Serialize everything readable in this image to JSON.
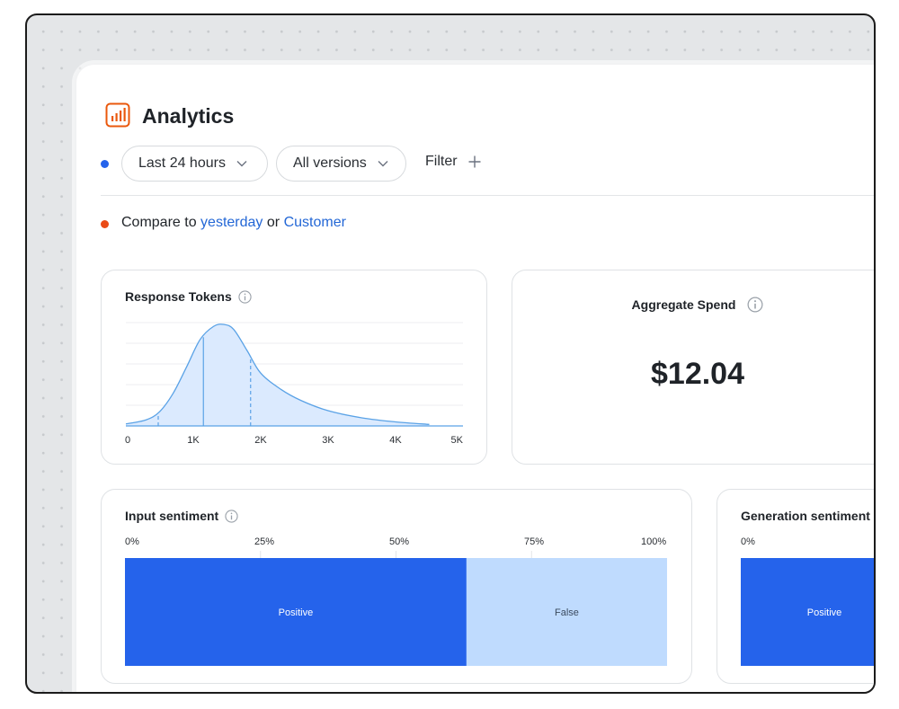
{
  "header": {
    "title": "Analytics",
    "icon": "bar-chart-icon",
    "accent": "#ea580c"
  },
  "filters": {
    "time_range": "Last 24 hours",
    "versions": "All versions",
    "filter_label": "Filter"
  },
  "compare": {
    "prefix": "Compare to",
    "link1": "yesterday",
    "conj": "or",
    "link2": "Customer"
  },
  "response_tokens": {
    "title": "Response Tokens",
    "chart_data": {
      "type": "area",
      "title": "Response Tokens",
      "x_ticks": [
        "0",
        "1K",
        "2K",
        "3K",
        "4K",
        "5K"
      ],
      "xlim": [
        0,
        5000
      ],
      "x": [
        0,
        300,
        500,
        700,
        900,
        1100,
        1300,
        1450,
        1600,
        1800,
        2000,
        2300,
        2600,
        3000,
        3500,
        4000,
        4500
      ],
      "y": [
        0.02,
        0.06,
        0.14,
        0.32,
        0.58,
        0.85,
        0.98,
        1.0,
        0.95,
        0.74,
        0.52,
        0.36,
        0.25,
        0.15,
        0.08,
        0.04,
        0.015
      ],
      "markers": [
        {
          "x": 480,
          "style": "dashed"
        },
        {
          "x": 1150,
          "style": "solid"
        },
        {
          "x": 1850,
          "style": "dashed"
        }
      ],
      "series_color": "#5aa2e6",
      "fill_color": "#dbeafe"
    }
  },
  "aggregate_spend": {
    "title": "Aggregate Spend",
    "value": "$12.04"
  },
  "input_sentiment": {
    "title": "Input sentiment",
    "ticks": [
      "0%",
      "25%",
      "50%",
      "75%",
      "100%"
    ],
    "chart_data": {
      "type": "bar",
      "orientation": "horizontal-stacked",
      "segments": [
        {
          "label": "Positive",
          "value": 63,
          "color": "#2563eb"
        },
        {
          "label": "False",
          "value": 37,
          "color": "#bfdbfe"
        }
      ],
      "xlim": [
        0,
        100
      ]
    }
  },
  "generation_sentiment": {
    "title": "Generation sentiment",
    "first_tick": "0%",
    "chart_data": {
      "type": "bar",
      "orientation": "horizontal-stacked",
      "segments": [
        {
          "label": "Positive",
          "color": "#2563eb"
        }
      ]
    }
  }
}
